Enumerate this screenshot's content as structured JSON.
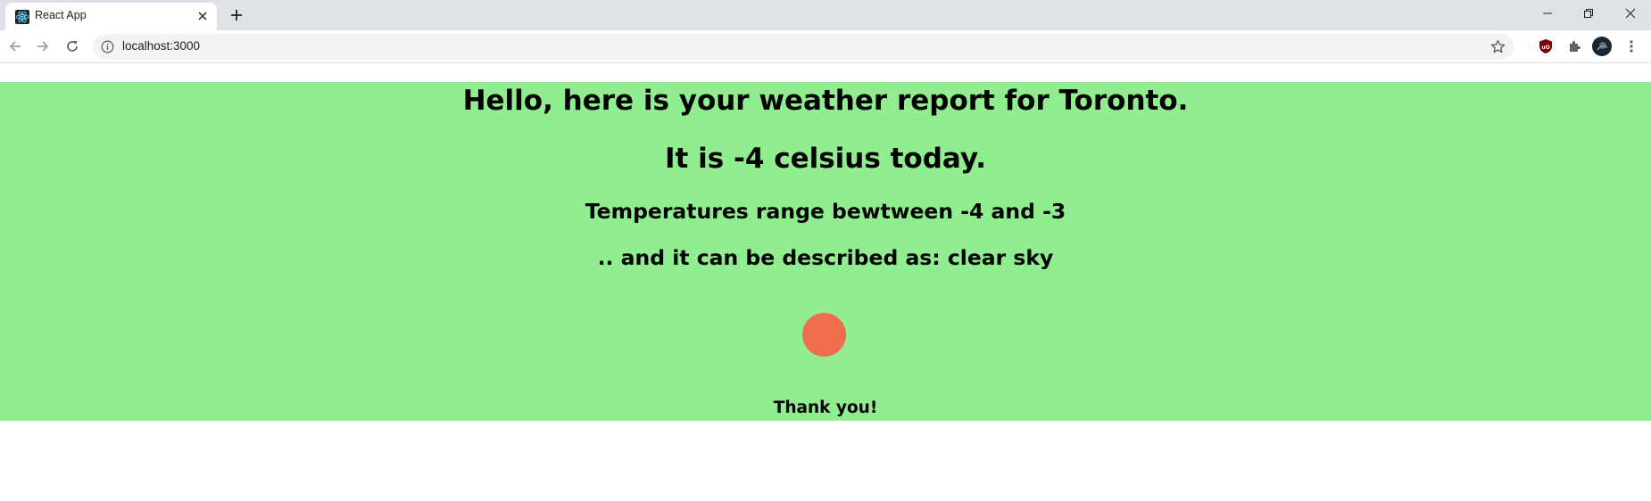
{
  "browser": {
    "tab_title": "React App",
    "url": "localhost:3000",
    "icons": {
      "favicon": "react-logo-icon",
      "tab_close": "close-icon",
      "new_tab": "plus-icon",
      "back": "arrow-left-icon",
      "forward": "arrow-right-icon",
      "reload": "reload-icon",
      "site_info": "info-icon",
      "bookmark": "star-icon",
      "ublock": "ublock-shield-icon",
      "extensions": "puzzle-icon",
      "profile": "avatar-icon",
      "menu": "kebab-menu-icon",
      "minimize": "minimize-icon",
      "restore": "restore-icon",
      "close_window": "close-icon"
    }
  },
  "app": {
    "background_color": "#90ee90",
    "greeting": "Hello, here is your weather report for Toronto.",
    "temperature_line": "It is -4 celsius today.",
    "range_line": "Temperatures range bewtween -4 and -3",
    "description_line": ".. and it can be described as: clear sky",
    "indicator_color": "#ef6e4e",
    "thanks": "Thank you!"
  }
}
